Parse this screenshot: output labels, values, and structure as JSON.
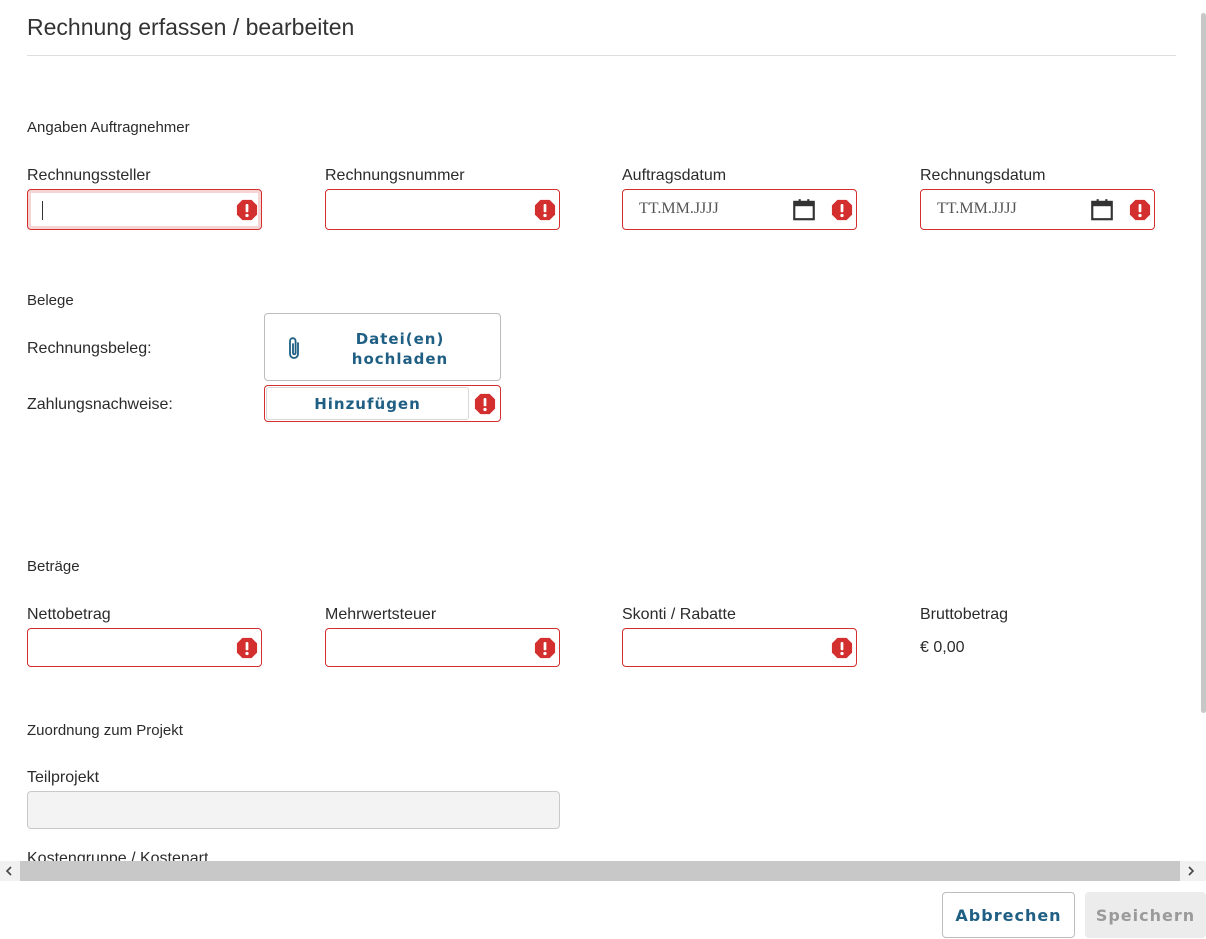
{
  "header": {
    "title": "Rechnung erfassen / bearbeiten"
  },
  "auftragnehmer": {
    "section_title": "Angaben Auftragnehmer",
    "fields": {
      "rechnungssteller": {
        "label": "Rechnungssteller",
        "value": ""
      },
      "rechnungsnummer": {
        "label": "Rechnungsnummer",
        "value": ""
      },
      "auftragsdatum": {
        "label": "Auftragsdatum",
        "placeholder": "TT.MM.JJJJ"
      },
      "rechnungsdatum": {
        "label": "Rechnungsdatum",
        "placeholder": "TT.MM.JJJJ"
      }
    }
  },
  "belege": {
    "section_title": "Belege",
    "rechnungsbeleg_label": "Rechnungsbeleg:",
    "upload_button_line1": "Datei(en)",
    "upload_button_line2": "hochladen",
    "zahlungsnachweise_label": "Zahlungsnachweise:",
    "add_button": "Hinzufügen"
  },
  "betraege": {
    "section_title": "Beträge",
    "nettobetrag_label": "Nettobetrag",
    "mehrwertsteuer_label": "Mehrwertsteuer",
    "skonti_label": "Skonti / Rabatte",
    "brutto_label": "Bruttobetrag",
    "brutto_value": "€ 0,00"
  },
  "projekt": {
    "section_title": "Zuordnung zum Projekt",
    "teilprojekt_label": "Teilprojekt",
    "kostengruppe_label": "Kostengruppe / Kostenart"
  },
  "footer": {
    "cancel": "Abbrechen",
    "save": "Speichern"
  },
  "colors": {
    "error": "#d32f2f",
    "accent_text": "#1f5f84"
  },
  "icons": {
    "error": "alert-icon",
    "calendar": "calendar-icon",
    "attachment": "paperclip-icon"
  }
}
